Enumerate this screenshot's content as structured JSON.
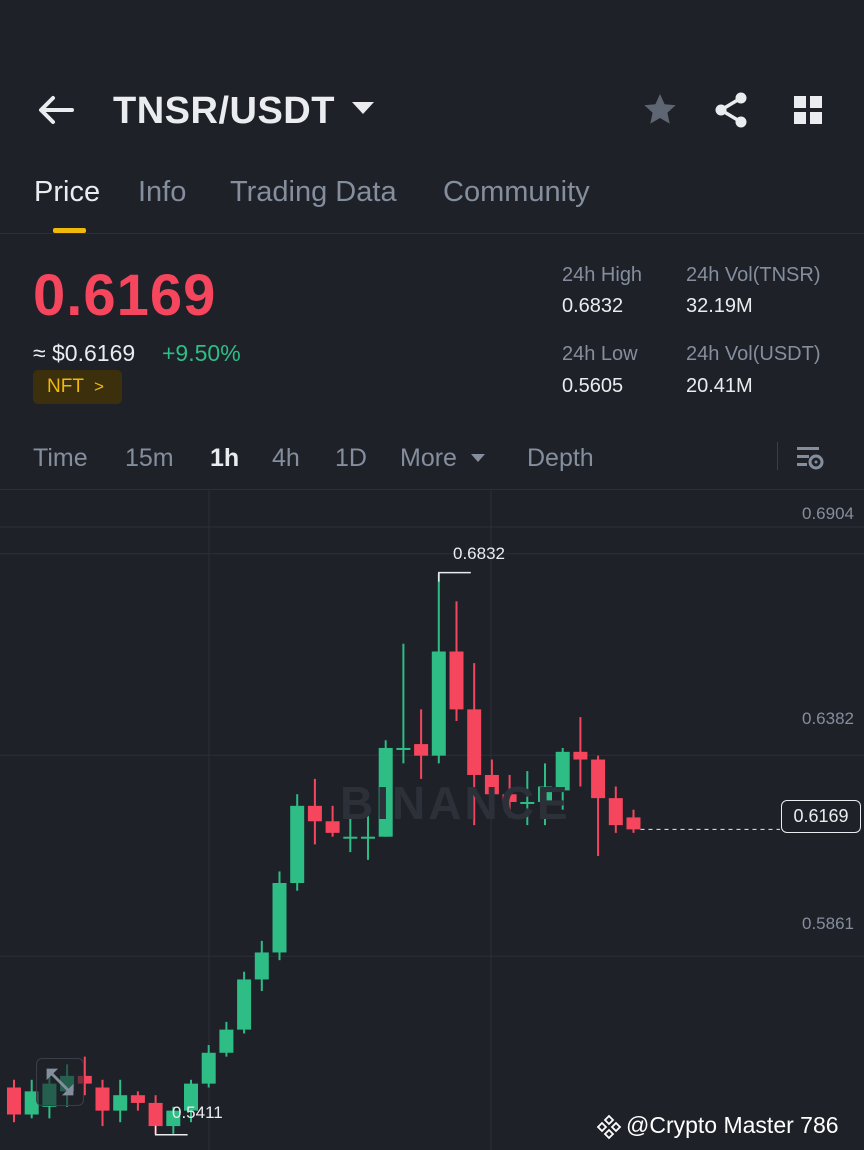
{
  "header": {
    "pair": "TNSR/USDT",
    "icons": [
      "back-arrow-icon",
      "chevron-down-icon",
      "star-icon",
      "share-icon",
      "grid-icon"
    ]
  },
  "tabs": [
    {
      "label": "Price",
      "active": true
    },
    {
      "label": "Info",
      "active": false
    },
    {
      "label": "Trading Data",
      "active": false
    },
    {
      "label": "Community",
      "active": false
    }
  ],
  "ticker": {
    "last_price": "0.6169",
    "usd_value": "≈ $0.6169",
    "change": "+9.50%",
    "badge": "NFT",
    "badge_arrow": ">"
  },
  "stats": {
    "high_label": "24h High",
    "high": "0.6832",
    "low_label": "24h Low",
    "low": "0.5605",
    "vol_base_label": "24h Vol(TNSR)",
    "vol_base": "32.19M",
    "vol_quote_label": "24h Vol(USDT)",
    "vol_quote": "20.41M"
  },
  "intervals": [
    {
      "label": "Time",
      "active": false
    },
    {
      "label": "15m",
      "active": false
    },
    {
      "label": "1h",
      "active": true
    },
    {
      "label": "4h",
      "active": false
    },
    {
      "label": "1D",
      "active": false
    },
    {
      "label": "More",
      "active": false
    },
    {
      "label": "Depth",
      "active": false
    }
  ],
  "colors": {
    "up": "#2ebd85",
    "down": "#f6465d",
    "accent": "#f0b90b",
    "bg": "#1f2129"
  },
  "chart_data": {
    "type": "candlestick",
    "interval": "1h",
    "y_ticks": [
      "0.6904",
      "0.6382",
      "0.5861"
    ],
    "ylim": [
      0.5338,
      0.7046
    ],
    "last_price_label": "0.6169",
    "high_annotation": "0.6832",
    "low_annotation": "0.5411",
    "watermark": "BINANCE",
    "candles": [
      {
        "o": 0.55,
        "h": 0.552,
        "l": 0.541,
        "c": 0.543
      },
      {
        "o": 0.543,
        "h": 0.552,
        "l": 0.542,
        "c": 0.549
      },
      {
        "o": 0.545,
        "h": 0.553,
        "l": 0.542,
        "c": 0.551
      },
      {
        "o": 0.549,
        "h": 0.556,
        "l": 0.545,
        "c": 0.553
      },
      {
        "o": 0.553,
        "h": 0.558,
        "l": 0.548,
        "c": 0.551
      },
      {
        "o": 0.55,
        "h": 0.552,
        "l": 0.54,
        "c": 0.544
      },
      {
        "o": 0.544,
        "h": 0.552,
        "l": 0.541,
        "c": 0.548
      },
      {
        "o": 0.548,
        "h": 0.549,
        "l": 0.544,
        "c": 0.546
      },
      {
        "o": 0.546,
        "h": 0.548,
        "l": 0.538,
        "c": 0.54
      },
      {
        "o": 0.54,
        "h": 0.545,
        "l": 0.538,
        "c": 0.544
      },
      {
        "o": 0.544,
        "h": 0.552,
        "l": 0.541,
        "c": 0.551
      },
      {
        "o": 0.551,
        "h": 0.561,
        "l": 0.55,
        "c": 0.559
      },
      {
        "o": 0.559,
        "h": 0.567,
        "l": 0.558,
        "c": 0.565
      },
      {
        "o": 0.565,
        "h": 0.58,
        "l": 0.564,
        "c": 0.578
      },
      {
        "o": 0.578,
        "h": 0.588,
        "l": 0.575,
        "c": 0.585
      },
      {
        "o": 0.585,
        "h": 0.606,
        "l": 0.583,
        "c": 0.603
      },
      {
        "o": 0.603,
        "h": 0.626,
        "l": 0.601,
        "c": 0.623
      },
      {
        "o": 0.623,
        "h": 0.63,
        "l": 0.613,
        "c": 0.619
      },
      {
        "o": 0.619,
        "h": 0.623,
        "l": 0.615,
        "c": 0.616
      },
      {
        "o": 0.615,
        "h": 0.62,
        "l": 0.611,
        "c": 0.615
      },
      {
        "o": 0.615,
        "h": 0.623,
        "l": 0.609,
        "c": 0.615
      },
      {
        "o": 0.615,
        "h": 0.64,
        "l": 0.615,
        "c": 0.638
      },
      {
        "o": 0.638,
        "h": 0.665,
        "l": 0.634,
        "c": 0.638
      },
      {
        "o": 0.639,
        "h": 0.648,
        "l": 0.63,
        "c": 0.636
      },
      {
        "o": 0.636,
        "h": 0.6832,
        "l": 0.634,
        "c": 0.663
      },
      {
        "o": 0.663,
        "h": 0.676,
        "l": 0.645,
        "c": 0.648
      },
      {
        "o": 0.648,
        "h": 0.66,
        "l": 0.618,
        "c": 0.631
      },
      {
        "o": 0.631,
        "h": 0.635,
        "l": 0.62,
        "c": 0.626
      },
      {
        "o": 0.626,
        "h": 0.631,
        "l": 0.62,
        "c": 0.624
      },
      {
        "o": 0.624,
        "h": 0.632,
        "l": 0.618,
        "c": 0.624
      },
      {
        "o": 0.624,
        "h": 0.634,
        "l": 0.618,
        "c": 0.628
      },
      {
        "o": 0.627,
        "h": 0.638,
        "l": 0.622,
        "c": 0.637
      },
      {
        "o": 0.637,
        "h": 0.646,
        "l": 0.628,
        "c": 0.635
      },
      {
        "o": 0.635,
        "h": 0.636,
        "l": 0.61,
        "c": 0.625
      },
      {
        "o": 0.625,
        "h": 0.628,
        "l": 0.616,
        "c": 0.618
      },
      {
        "o": 0.62,
        "h": 0.622,
        "l": 0.616,
        "c": 0.6169
      }
    ]
  },
  "credit": "@Crypto Master 786"
}
